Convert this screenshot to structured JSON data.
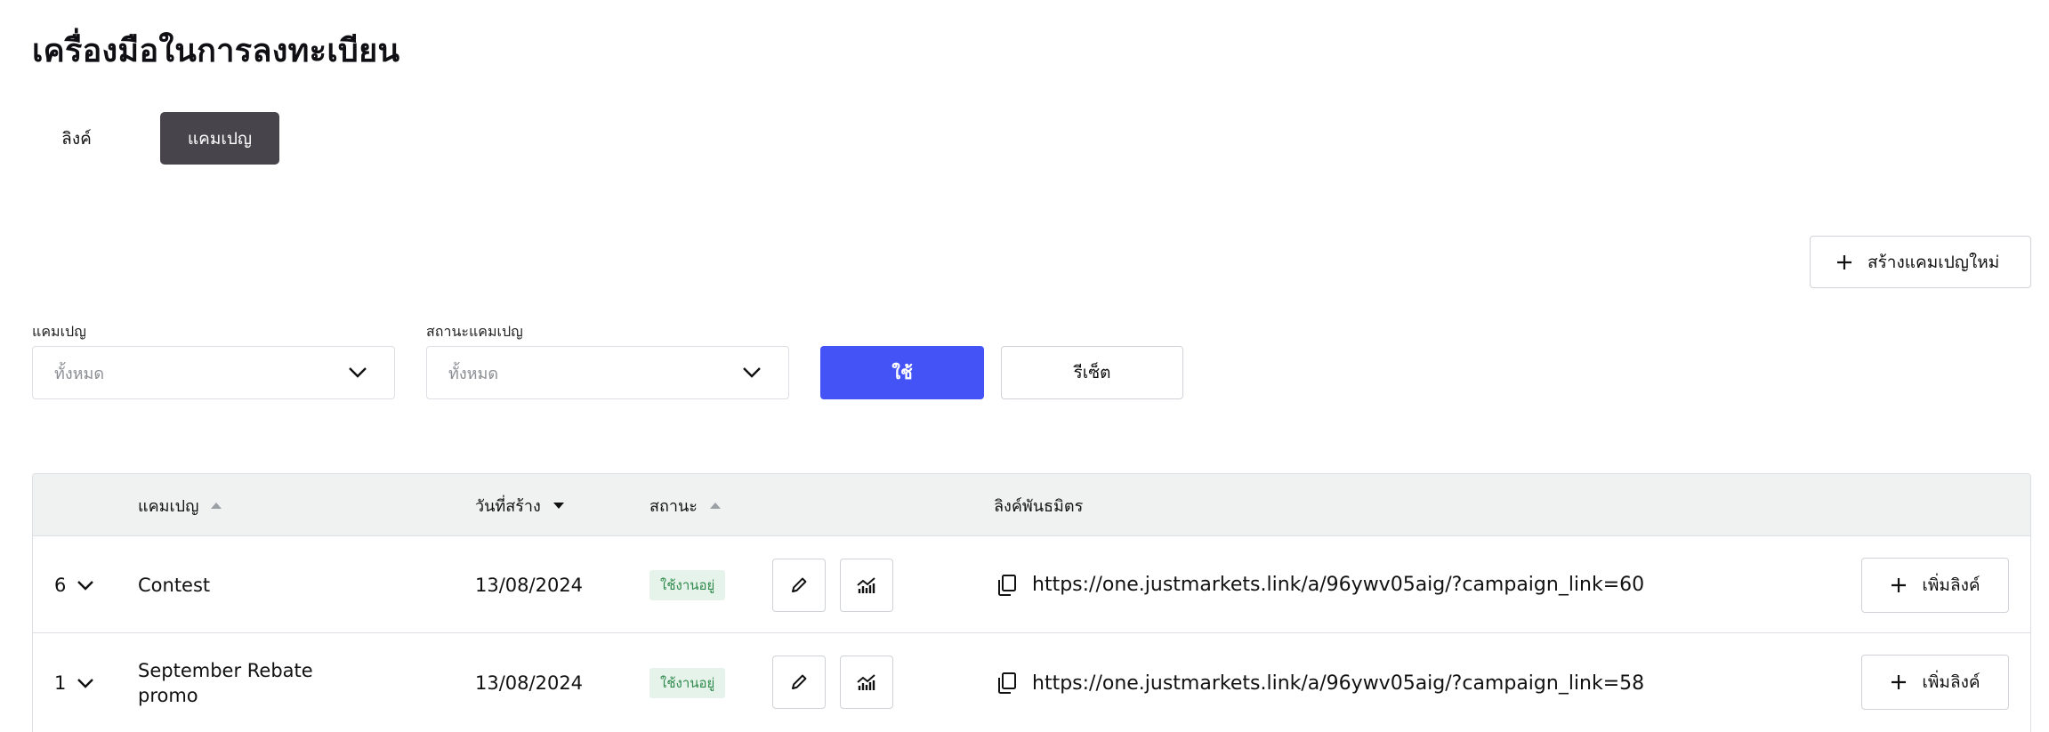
{
  "page": {
    "title": "เครื่องมือในการลงทะเบียน"
  },
  "tabs": [
    {
      "label": "ลิงค์",
      "active": false
    },
    {
      "label": "แคมเปญ",
      "active": true
    }
  ],
  "create_button": {
    "label": "สร้างแคมเปญใหม่",
    "icon": "plus-icon"
  },
  "filters": {
    "campaign": {
      "label": "แคมเปญ",
      "placeholder": "ทั้งหมด"
    },
    "status": {
      "label": "สถานะแคมเปญ",
      "placeholder": "ทั้งหมด"
    },
    "apply_label": "ใช้",
    "reset_label": "รีเซ็ต"
  },
  "colors": {
    "accent": "#4353f5",
    "active_tab": "#47454b",
    "badge_bg": "#e6f3ea",
    "badge_text": "#2f8a4c",
    "header_bg": "#f0f2f2"
  },
  "table": {
    "headers": {
      "campaign": "แคมเปญ",
      "created": "วันที่สร้าง",
      "status": "สถานะ",
      "affiliate_link": "ลิงค์พันธมิตร"
    },
    "rows": [
      {
        "count": "6",
        "name": "Contest",
        "created": "13/08/2024",
        "status": "ใช้งานอยู่",
        "link": "https://one.justmarkets.link/a/96ywv05aig/?campaign_link=60",
        "add_link_label": "เพิ่มลิงค์"
      },
      {
        "count": "1",
        "name": "September Rebate promo",
        "created": "13/08/2024",
        "status": "ใช้งานอยู่",
        "link": "https://one.justmarkets.link/a/96ywv05aig/?campaign_link=58",
        "add_link_label": "เพิ่มลิงค์"
      }
    ]
  }
}
